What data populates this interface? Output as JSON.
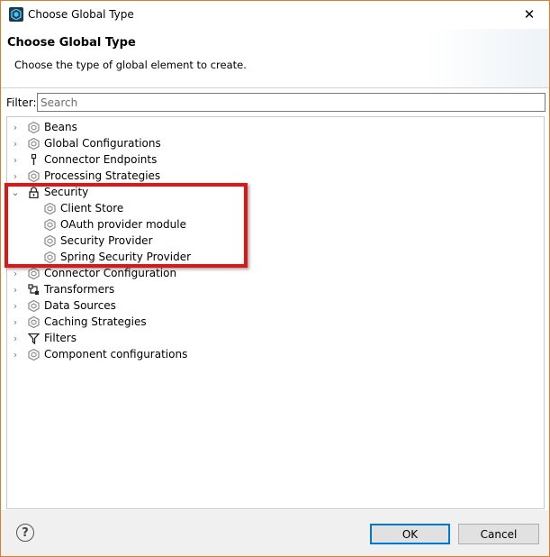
{
  "window": {
    "title": "Choose Global Type",
    "close_glyph": "✕"
  },
  "banner": {
    "title": "Choose Global Type",
    "description": "Choose the type of global element to create."
  },
  "filter": {
    "label": "Filter:",
    "placeholder": "Search"
  },
  "tree": {
    "items": [
      {
        "label": "Beans",
        "icon": "mule-hex-icon",
        "expanded": false
      },
      {
        "label": "Global Configurations",
        "icon": "mule-hex-icon",
        "expanded": false
      },
      {
        "label": "Connector Endpoints",
        "icon": "endpoint-icon",
        "expanded": false
      },
      {
        "label": "Processing Strategies",
        "icon": "mule-hex-icon",
        "expanded": false
      },
      {
        "label": "Security",
        "icon": "lock-icon",
        "expanded": true,
        "children": [
          {
            "label": "Client Store",
            "icon": "mule-hex-icon"
          },
          {
            "label": "OAuth provider module",
            "icon": "mule-hex-icon"
          },
          {
            "label": "Security Provider",
            "icon": "mule-hex-icon"
          },
          {
            "label": "Spring Security Provider",
            "icon": "mule-hex-icon"
          }
        ]
      },
      {
        "label": "Connector Configuration",
        "icon": "mule-hex-icon",
        "expanded": false
      },
      {
        "label": "Transformers",
        "icon": "transformer-icon",
        "expanded": false
      },
      {
        "label": "Data Sources",
        "icon": "mule-hex-icon",
        "expanded": false
      },
      {
        "label": "Caching Strategies",
        "icon": "mule-hex-icon",
        "expanded": false
      },
      {
        "label": "Filters",
        "icon": "filter-icon",
        "expanded": false
      },
      {
        "label": "Component configurations",
        "icon": "mule-hex-icon",
        "expanded": false
      }
    ]
  },
  "footer": {
    "help_glyph": "?",
    "ok_label": "OK",
    "cancel_label": "Cancel"
  },
  "colors": {
    "highlight": "#e01515",
    "ok_border": "#0078d7",
    "window_border": "#e07b2b"
  }
}
